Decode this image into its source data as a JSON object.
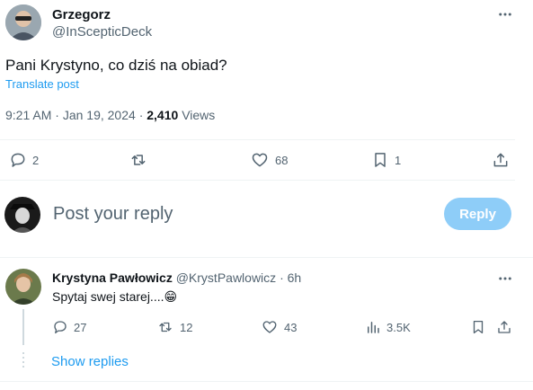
{
  "post": {
    "author_name": "Grzegorz",
    "author_handle": "@InScepticDeck",
    "text": "Pani Krystyno, co dziś na obiad?",
    "translate_label": "Translate post",
    "time": "9:21 AM",
    "sep1": "·",
    "date": "Jan 19, 2024",
    "sep2": "·",
    "views_count": "2,410",
    "views_label": "Views",
    "more_icon": "more-horizontal-icon",
    "actions": {
      "replies": "2",
      "reposts": "",
      "likes": "68",
      "bookmarks": "1"
    }
  },
  "composer": {
    "placeholder": "Post your reply",
    "reply_button": "Reply"
  },
  "reply": {
    "author_name": "Krystyna Pawłowicz",
    "author_handle": "@KrystPawlowicz",
    "sep": "·",
    "age": "6h",
    "text": "Spytaj swej starej....",
    "emoji": "😁",
    "actions": {
      "replies": "27",
      "reposts": "12",
      "likes": "43",
      "views": "3.5K"
    },
    "show_replies": "Show replies"
  },
  "colors": {
    "accent": "#1d9bf0",
    "accent_disabled": "#8ecdf8",
    "muted": "#536471",
    "divider": "#eff3f4",
    "thread_line": "#cfd9de"
  }
}
